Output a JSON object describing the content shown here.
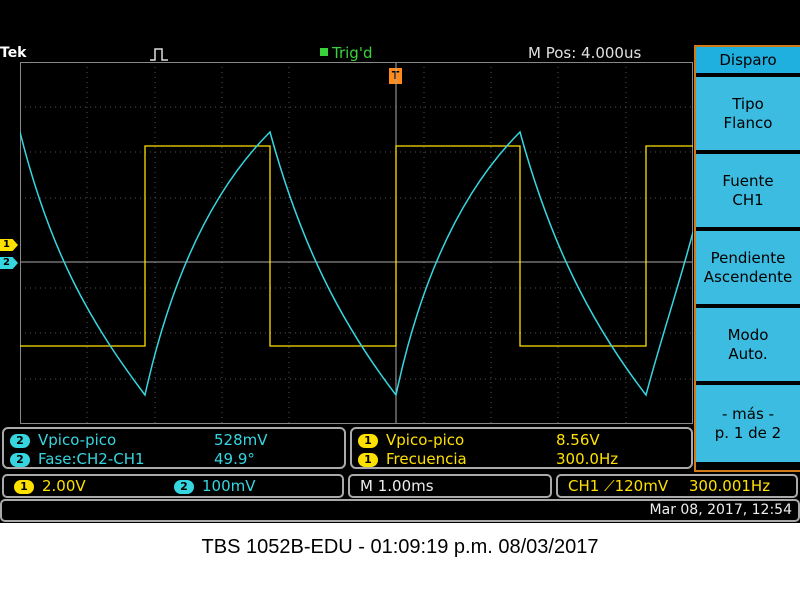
{
  "header": {
    "brand": "Tek",
    "trigger_status": "Trig'd",
    "m_pos": "M Pos: 4.000us"
  },
  "markers": {
    "ch1": "1",
    "ch2": "2",
    "trigger": "T"
  },
  "side_menu": {
    "title": "Disparo",
    "buttons": [
      {
        "line1": "Tipo",
        "line2": "Flanco"
      },
      {
        "line1": "Fuente",
        "line2": "CH1"
      },
      {
        "line1": "Pendiente",
        "line2": "Ascendente"
      },
      {
        "line1": "Modo",
        "line2": "Auto."
      },
      {
        "line1": "- más -",
        "line2": "p. 1 de 2"
      }
    ]
  },
  "measurements": {
    "left": [
      {
        "ch": "2",
        "label": "Vpico-pico",
        "value": "528mV"
      },
      {
        "ch": "2",
        "label": "Fase:CH2-CH1",
        "value": "49.9°"
      }
    ],
    "right": [
      {
        "ch": "1",
        "label": "Vpico-pico",
        "value": "8.56V"
      },
      {
        "ch": "1",
        "label": "Frecuencia",
        "value": "300.0Hz"
      }
    ]
  },
  "status": {
    "ch1_num": "1",
    "ch1_scale": "2.00V",
    "ch2_num": "2",
    "ch2_scale": "100mV",
    "timebase": "M 1.00ms",
    "trigger_src": "CH1",
    "trigger_slope": "⟋",
    "trigger_level": "120mV",
    "trigger_freq": "300.001Hz"
  },
  "datetime": "Mar 08, 2017, 12:54",
  "caption": "TBS 1052B-EDU - 01:09:19 p.m.   08/03/2017",
  "colors": {
    "ch1": "#ffe100",
    "ch2": "#36d6e0",
    "trigger": "#3ad23a",
    "menu_border": "#d07a1a"
  }
}
